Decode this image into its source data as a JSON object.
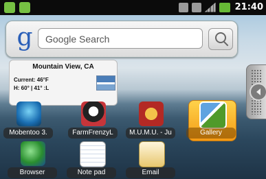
{
  "status_bar": {
    "time": "21:40"
  },
  "search_widget": {
    "logo_letter": "g",
    "placeholder": "Google Search"
  },
  "weather_widget": {
    "city": "Mountain View, CA",
    "current": "Current: 46°F",
    "range": "H: 60° | 41° :L"
  },
  "apps": [
    {
      "label": "Mobentoo 3.",
      "icon": "mobentoo-app-icon"
    },
    {
      "label": "FarmFrenzyL",
      "icon": "farm-frenzy-app-icon"
    },
    {
      "label": "M.U.M.U. - Ju",
      "icon": "mumu-app-icon"
    },
    {
      "label": "Gallery",
      "icon": "gallery-app-icon"
    },
    {
      "label": "Browser",
      "icon": "browser-app-icon"
    },
    {
      "label": "Note pad",
      "icon": "notepad-app-icon"
    },
    {
      "label": "Email",
      "icon": "email-app-icon"
    }
  ],
  "colors": {
    "status_bar": "#0b0b0b",
    "gallery_highlight": "#f39a15",
    "google_blue": "#2a5fb8"
  }
}
